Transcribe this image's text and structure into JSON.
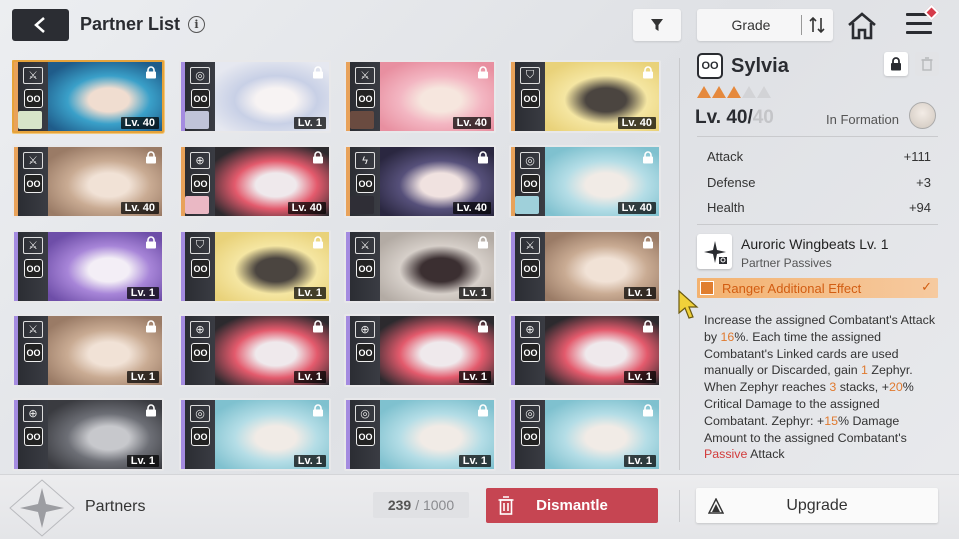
{
  "header": {
    "title": "Partner List",
    "info_icon": "info-icon",
    "back_icon": "back-arrow-icon",
    "filter_icon": "filter-icon",
    "sort_label": "Grade",
    "sort_icon": "sort-order-icon",
    "home_icon": "home-icon",
    "menu_icon": "menu-icon"
  },
  "colors": {
    "accent_orange": "#e5893d",
    "dismantle_red": "#c64552",
    "selected_border": "#e6a33b",
    "rarity_orange": "#e8a25a",
    "rarity_purple": "#a48be0"
  },
  "cards": [
    {
      "level": "Lv. 40",
      "class_icon": "crossed-swords-icon",
      "rarity": "orange",
      "locked": true,
      "selected": true,
      "palette": [
        "#1f5c8a",
        "#3aa0c9",
        "#f0ddd0"
      ],
      "mini": "#d7e4c9"
    },
    {
      "level": "Lv. 1",
      "class_icon": "target-icon",
      "rarity": "purple",
      "locked": true,
      "selected": false,
      "palette": [
        "#e6e8f0",
        "#c8d0e6",
        "#f7f3f3"
      ],
      "mini": "#c0c3d8"
    },
    {
      "level": "Lv. 40",
      "class_icon": "crossed-swords-icon",
      "rarity": "orange",
      "locked": true,
      "selected": false,
      "palette": [
        "#e88fa0",
        "#f3b6c2",
        "#f6e6de"
      ],
      "mini": "#6a4b40"
    },
    {
      "level": "Lv. 40",
      "class_icon": "shield-icon",
      "rarity": "orange",
      "locked": true,
      "selected": false,
      "palette": [
        "#e9d27a",
        "#f5e6a2",
        "#4b4540"
      ],
      "mini": null
    },
    {
      "level": "Lv. 40",
      "class_icon": "crossed-swords-icon",
      "rarity": "orange",
      "locked": true,
      "selected": false,
      "palette": [
        "#9a7b66",
        "#c9ab93",
        "#f1e2d6"
      ],
      "mini": null
    },
    {
      "level": "Lv. 40",
      "class_icon": "crosshair-icon",
      "rarity": "orange",
      "locked": true,
      "selected": false,
      "palette": [
        "#2c2a2e",
        "#e35a6c",
        "#efe9ec"
      ],
      "mini": "#eab8c4"
    },
    {
      "level": "Lv. 40",
      "class_icon": "lightning-icon",
      "rarity": "orange",
      "locked": true,
      "selected": false,
      "palette": [
        "#2a2740",
        "#56507a",
        "#f0e2e0"
      ],
      "mini": "#2f2e36"
    },
    {
      "level": "Lv. 40",
      "class_icon": "target-icon",
      "rarity": "orange",
      "locked": true,
      "selected": false,
      "palette": [
        "#7fc1cf",
        "#b4dde6",
        "#f1ebe6"
      ],
      "mini": "#9fd0da"
    },
    {
      "level": "Lv. 1",
      "class_icon": "crossed-swords-icon",
      "rarity": "purple",
      "locked": true,
      "selected": false,
      "palette": [
        "#6e4ea8",
        "#a785d8",
        "#f3eef6"
      ],
      "mini": null
    },
    {
      "level": "Lv. 1",
      "class_icon": "shield-icon",
      "rarity": "purple",
      "locked": true,
      "selected": false,
      "palette": [
        "#e9d27a",
        "#f5e6a2",
        "#4b4540"
      ],
      "mini": null
    },
    {
      "level": "Lv. 1",
      "class_icon": "crossed-swords-icon",
      "rarity": "purple",
      "locked": true,
      "selected": false,
      "palette": [
        "#b3aba4",
        "#d6cfc9",
        "#3b2f31"
      ],
      "mini": null
    },
    {
      "level": "Lv. 1",
      "class_icon": "crossed-swords-icon",
      "rarity": "purple",
      "locked": true,
      "selected": false,
      "palette": [
        "#9a7b66",
        "#c9ab93",
        "#f1e2d6"
      ],
      "mini": null
    },
    {
      "level": "Lv. 1",
      "class_icon": "crossed-swords-icon",
      "rarity": "purple",
      "locked": true,
      "selected": false,
      "palette": [
        "#9a7b66",
        "#c9ab93",
        "#f1e2d6"
      ],
      "mini": null
    },
    {
      "level": "Lv. 1",
      "class_icon": "crosshair-icon",
      "rarity": "purple",
      "locked": true,
      "selected": false,
      "palette": [
        "#2c2a2e",
        "#e35a6c",
        "#efe9ec"
      ],
      "mini": null
    },
    {
      "level": "Lv. 1",
      "class_icon": "crosshair-icon",
      "rarity": "purple",
      "locked": true,
      "selected": false,
      "palette": [
        "#2c2a2e",
        "#e35a6c",
        "#efe9ec"
      ],
      "mini": null
    },
    {
      "level": "Lv. 1",
      "class_icon": "crosshair-icon",
      "rarity": "purple",
      "locked": true,
      "selected": false,
      "palette": [
        "#2c2a2e",
        "#e35a6c",
        "#efe9ec"
      ],
      "mini": null
    },
    {
      "level": "Lv. 1",
      "class_icon": "crosshair-icon",
      "rarity": "purple",
      "locked": true,
      "selected": false,
      "palette": [
        "#3a3b40",
        "#6d6f76",
        "#c7c8cc"
      ],
      "mini": null
    },
    {
      "level": "Lv. 1",
      "class_icon": "target-icon",
      "rarity": "purple",
      "locked": true,
      "selected": false,
      "palette": [
        "#7fc1cf",
        "#b4dde6",
        "#f1ebe6"
      ],
      "mini": null
    },
    {
      "level": "Lv. 1",
      "class_icon": "target-icon",
      "rarity": "purple",
      "locked": true,
      "selected": false,
      "palette": [
        "#7fc1cf",
        "#b4dde6",
        "#f1ebe6"
      ],
      "mini": null
    },
    {
      "level": "Lv. 1",
      "class_icon": "target-icon",
      "rarity": "purple",
      "locked": true,
      "selected": false,
      "palette": [
        "#7fc1cf",
        "#b4dde6",
        "#f1ebe6"
      ],
      "mini": null
    }
  ],
  "character": {
    "badge": "OO",
    "name": "Sylvia",
    "stars_filled": 3,
    "stars_total": 5,
    "level_current": "Lv. 40/",
    "level_max": "40",
    "formation_label": "In Formation",
    "stats": [
      {
        "label": "Attack",
        "value": "+111"
      },
      {
        "label": "Defense",
        "value": "+3"
      },
      {
        "label": "Health",
        "value": "+94"
      }
    ],
    "passive": {
      "title": "Auroric Wingbeats Lv. 1",
      "subtitle": "Partner Passives",
      "icon": "wing-sparkle-icon"
    },
    "effect_label": "Ranger Additional Effect",
    "description": [
      {
        "t": "Increase the assigned Combatant's Attack by "
      },
      {
        "t": "16",
        "c": "hl"
      },
      {
        "t": "%. Each time the assigned Combatant's Linked cards are used manually or Discarded, gain "
      },
      {
        "t": "1",
        "c": "hl"
      },
      {
        "t": " Zephyr. When Zephyr reaches "
      },
      {
        "t": "3",
        "c": "hl"
      },
      {
        "t": " stacks, +"
      },
      {
        "t": "20",
        "c": "hl"
      },
      {
        "t": "% Critical Damage to the assigned Combatant. Zephyr: +"
      },
      {
        "t": "15",
        "c": "hl"
      },
      {
        "t": "% Damage Amount to the assigned Combatant's "
      },
      {
        "t": "Passive",
        "c": "hl2"
      },
      {
        "t": " Attack"
      }
    ]
  },
  "footer": {
    "section_label": "Partners",
    "count_current": "239",
    "count_max": "/ 1000",
    "dismantle_label": "Dismantle",
    "upgrade_label": "Upgrade"
  }
}
